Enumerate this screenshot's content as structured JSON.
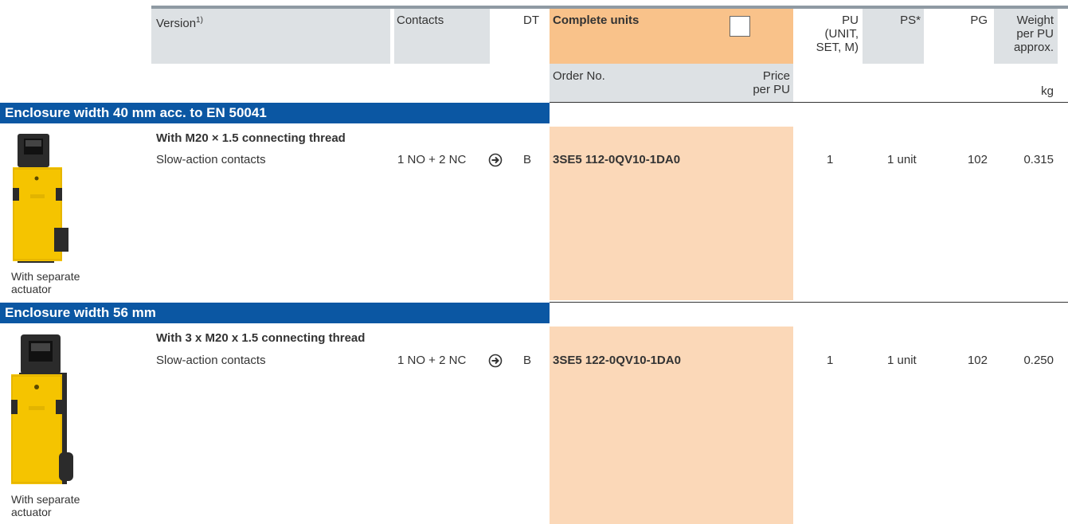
{
  "header": {
    "version_label": "Version",
    "version_sup": "1)",
    "contacts_label": "Contacts",
    "dt_label": "DT",
    "complete_units_label": "Complete units",
    "pu_label_1": "PU",
    "pu_label_2": "(UNIT,",
    "pu_label_3": "SET, M)",
    "ps_label": "PS*",
    "pg_label": "PG",
    "weight_label_1": "Weight",
    "weight_label_2": "per PU",
    "weight_label_3": "approx.",
    "order_no_label": "Order No.",
    "price_label_1": "Price",
    "price_label_2": "per PU",
    "kg_label": "kg"
  },
  "sections": [
    {
      "title": "Enclosure width 40 mm acc. to EN 50041",
      "subtitle": "With M20 × 1.5 connecting thread",
      "version": "Slow-action contacts",
      "contacts": "1 NO + 2 NC",
      "dt": "B",
      "order_no": "3SE5 112-0QV10-1DA0",
      "pu": "1",
      "ps": "1 unit",
      "pg": "102",
      "weight": "0.315",
      "caption_1": "With separate",
      "caption_2": "actuator"
    },
    {
      "title": "Enclosure width 56 mm",
      "subtitle": "With 3 x M20 x 1.5 connecting thread",
      "version": "Slow-action contacts",
      "contacts": "1 NO + 2 NC",
      "dt": "B",
      "order_no": "3SE5 122-0QV10-1DA0",
      "pu": "1",
      "ps": "1 unit",
      "pg": "102",
      "weight": "0.250",
      "caption_1": "With separate",
      "caption_2": "actuator"
    }
  ],
  "colors": {
    "section_bar": "#0b57a3",
    "header_grey": "#dde1e4",
    "header_orange": "#f9c28a",
    "order_column": "#fbd8b8",
    "switch_yellow": "#f5c400",
    "switch_black": "#2b2b2b"
  }
}
